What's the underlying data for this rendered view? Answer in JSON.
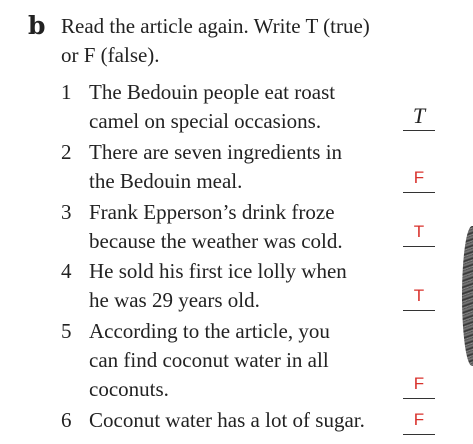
{
  "exercise": {
    "label": "b",
    "instruction_line1": "Read the article again. Write T (true)",
    "instruction_line2": "or F (false)."
  },
  "items": [
    {
      "number": "1",
      "lines": [
        "The Bedouin people eat roast",
        "camel on special occasions."
      ],
      "answer": "T",
      "answer_style": "printed"
    },
    {
      "number": "2",
      "lines": [
        "There are seven ingredients in",
        "the Bedouin meal."
      ],
      "answer": "F",
      "answer_style": "handwritten"
    },
    {
      "number": "3",
      "lines": [
        "Frank Epperson’s drink froze",
        "because the weather was cold."
      ],
      "answer": "T",
      "answer_style": "handwritten"
    },
    {
      "number": "4",
      "lines": [
        "He sold his first ice lolly when",
        "he was 29 years old."
      ],
      "answer": "T",
      "answer_style": "handwritten"
    },
    {
      "number": "5",
      "lines": [
        "According to the article, you",
        "can find coconut water in all",
        "coconuts."
      ],
      "answer": "F",
      "answer_style": "handwritten"
    },
    {
      "number": "6",
      "lines": [
        "Coconut water has a lot of sugar."
      ],
      "answer": "F",
      "answer_style": "handwritten"
    }
  ],
  "colors": {
    "text": "#222222",
    "handwritten_answer": "#d8322c"
  }
}
